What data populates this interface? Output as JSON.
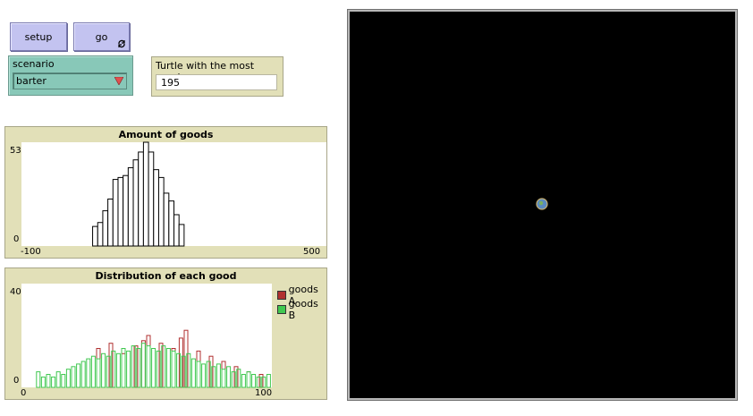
{
  "buttons": {
    "setup_label": "setup",
    "go_label": "go"
  },
  "chooser": {
    "title": "scenario",
    "value": "barter"
  },
  "monitor": {
    "title": "Turtle with the most goods",
    "value": "195"
  },
  "colors": {
    "button": "#c3c3f0",
    "chooser": "#88c8b8",
    "panel": "#e2e0b8",
    "goods_a": "#b03030",
    "goods_b": "#40c850",
    "view": "#000000"
  },
  "plot1": {
    "title": "Amount of goods",
    "y_max_label": "53",
    "y_min_label": "0",
    "x_min_label": "-100",
    "x_max_label": "500"
  },
  "plot2": {
    "title": "Distribution of each good",
    "y_max_label": "40",
    "y_min_label": "0",
    "x_min_label": "0",
    "x_max_label": "100",
    "legend": [
      {
        "label": "goods A",
        "color": "#b03030"
      },
      {
        "label": "goods B",
        "color": "#40c850"
      }
    ]
  },
  "chart_data": [
    {
      "type": "bar",
      "title": "Amount of goods",
      "xlim": [
        -100,
        500
      ],
      "ylim": [
        0,
        53
      ],
      "bin_width": 10,
      "x": [
        40,
        50,
        60,
        70,
        80,
        90,
        100,
        110,
        120,
        130,
        140,
        150,
        160,
        170,
        180,
        190,
        200,
        210
      ],
      "values": [
        10,
        12,
        18,
        24,
        34,
        35,
        36,
        40,
        44,
        48,
        53,
        48,
        39,
        35,
        27,
        23,
        16,
        11
      ]
    },
    {
      "type": "bar",
      "title": "Distribution of each good",
      "xlim": [
        0,
        100
      ],
      "ylim": [
        0,
        40
      ],
      "series": [
        {
          "name": "goods A",
          "color": "#b03030",
          "x": [
            30,
            35,
            40,
            45,
            48,
            50,
            55,
            60,
            63,
            65,
            70,
            75,
            80,
            85,
            90,
            95
          ],
          "values": [
            15,
            17,
            13,
            16,
            18,
            20,
            17,
            15,
            19,
            22,
            14,
            12,
            10,
            8,
            6,
            5
          ]
        },
        {
          "name": "goods B",
          "color": "#40c850",
          "x": [
            6,
            8,
            10,
            12,
            14,
            16,
            18,
            20,
            22,
            24,
            26,
            28,
            30,
            32,
            34,
            36,
            38,
            40,
            42,
            44,
            46,
            48,
            50,
            52,
            54,
            56,
            58,
            60,
            62,
            64,
            66,
            68,
            70,
            72,
            74,
            76,
            78,
            80,
            82,
            84,
            86,
            88,
            90,
            92,
            94,
            96,
            98
          ],
          "values": [
            6,
            4,
            5,
            4,
            6,
            5,
            7,
            8,
            9,
            10,
            11,
            12,
            11,
            13,
            12,
            14,
            13,
            15,
            14,
            16,
            15,
            17,
            16,
            15,
            14,
            16,
            15,
            14,
            13,
            12,
            13,
            11,
            10,
            9,
            10,
            8,
            9,
            7,
            8,
            6,
            7,
            5,
            6,
            5,
            4,
            4,
            5
          ]
        }
      ]
    }
  ]
}
